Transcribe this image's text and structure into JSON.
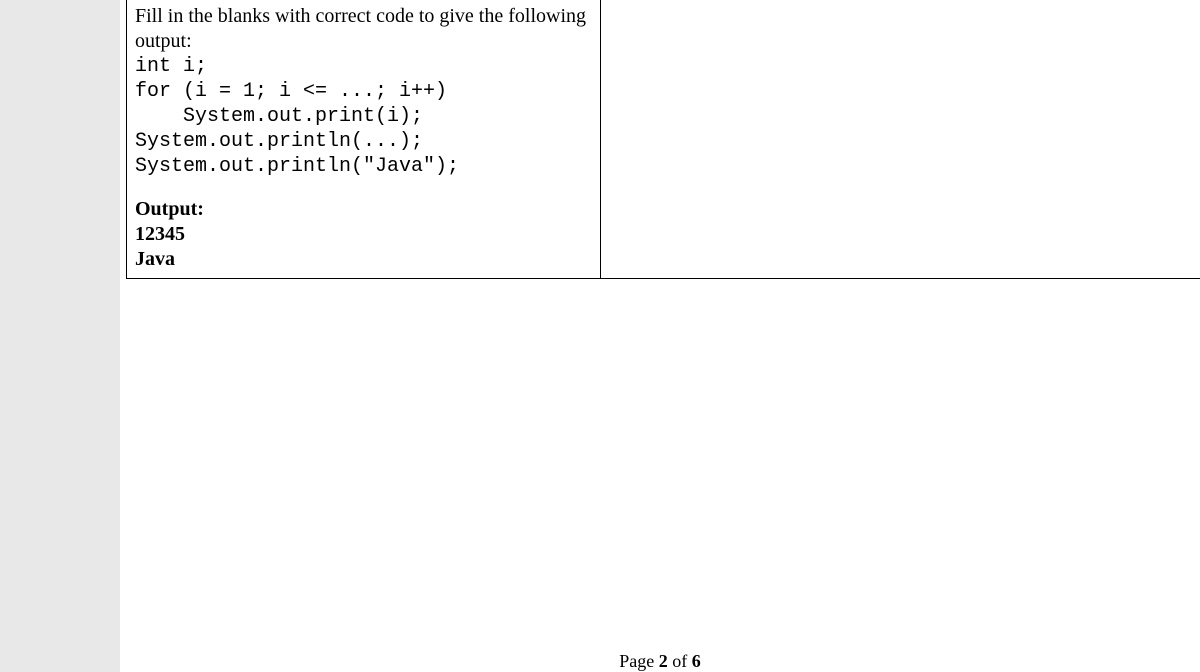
{
  "question": {
    "instruction_line1": "Fill in the blanks with correct code to give the following",
    "instruction_line2": "output:",
    "code_line1": "int i;",
    "code_line2": "for (i = 1; i <= ...; i++)",
    "code_line3": "    System.out.print(i);",
    "code_line4": "System.out.println(...);",
    "code_line5": "System.out.println(\"Java\");",
    "output_label": "Output:",
    "output_line1": "12345",
    "output_line2": "Java"
  },
  "footer": {
    "prefix": "Page ",
    "current": "2",
    "of": " of ",
    "total": "6"
  }
}
